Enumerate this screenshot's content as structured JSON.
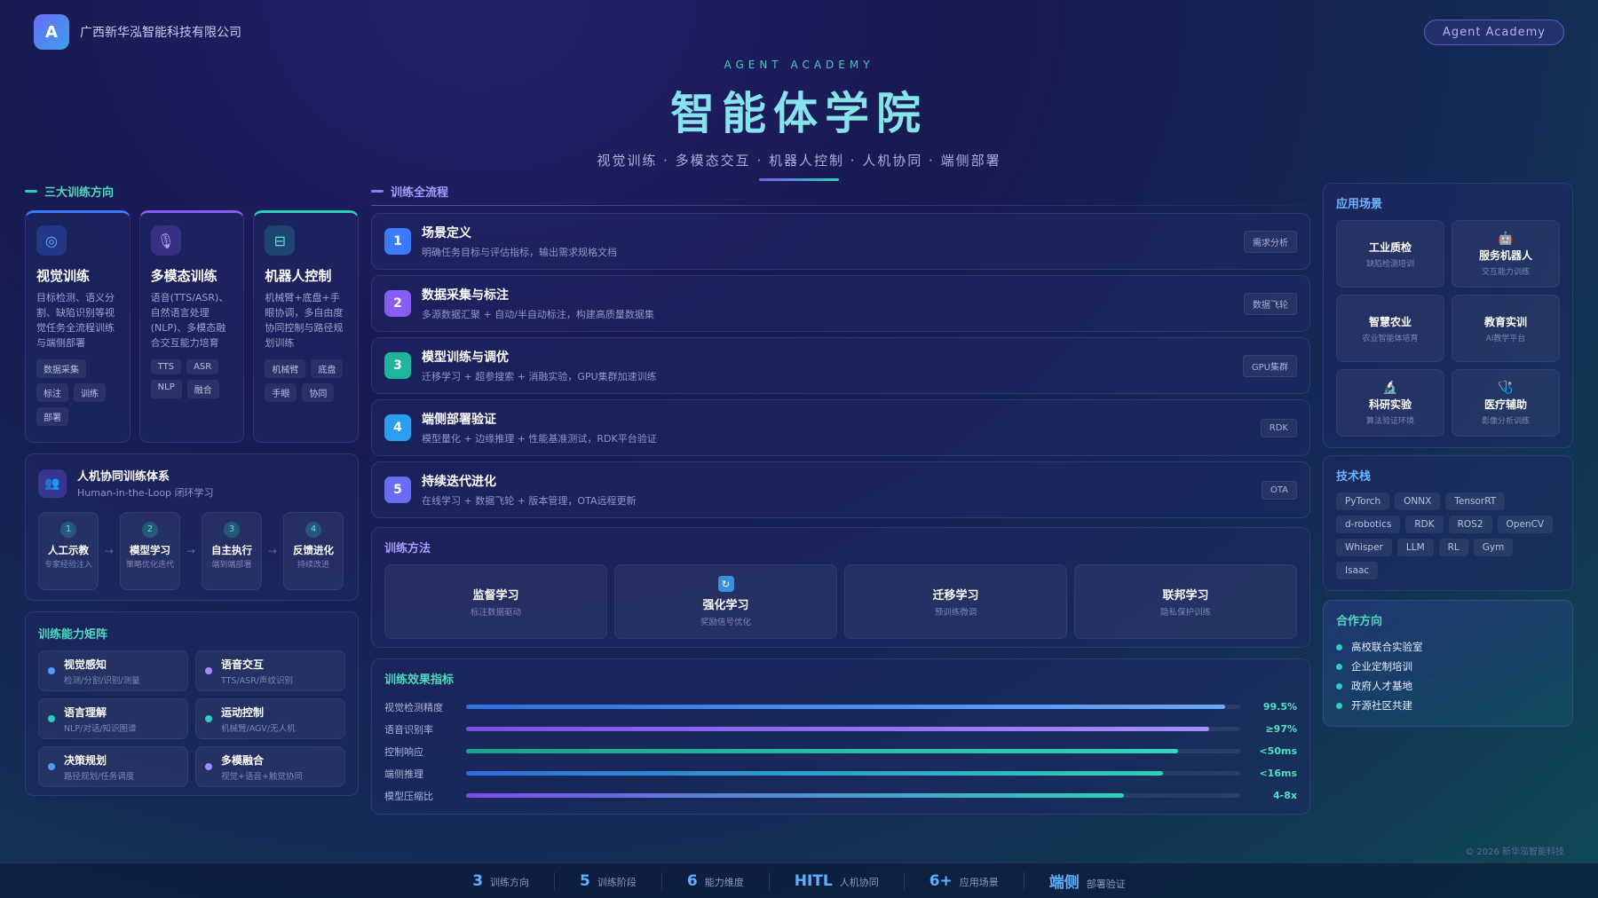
{
  "brand": {
    "logo_letter": "A",
    "name": "广西新华泓智能科技有限公司",
    "badge": "Agent Academy"
  },
  "hero": {
    "kicker": "AGENT ACADEMY",
    "title": "智能体学院",
    "subtitle": "视觉训练 · 多模态交互 · 机器人控制 · 人机协同 · 端侧部署"
  },
  "left": {
    "section_title": "三大训练方向",
    "directions": [
      {
        "icon": "target-icon",
        "glyph": "◎",
        "title": "视觉训练",
        "desc": "目标检测、语义分割、缺陷识别等视觉任务全流程训练与端侧部署",
        "chips": [
          "数据采集",
          "标注",
          "训练",
          "部署"
        ],
        "color": "#3b7bff"
      },
      {
        "icon": "microphone-icon",
        "glyph": "🎙",
        "title": "多模态训练",
        "desc": "语音(TTS/ASR)、自然语言处理(NLP)、多模态融合交互能力培育",
        "chips": [
          "TTS",
          "ASR",
          "NLP",
          "融合"
        ],
        "color": "#8a5cf6"
      },
      {
        "icon": "robot-control-icon",
        "glyph": "⊟",
        "title": "机器人控制",
        "desc": "机械臂+底盘+手眼协调，多自由度协同控制与路径规划训练",
        "chips": [
          "机械臂",
          "底盘",
          "手眼",
          "协同"
        ],
        "color": "#2ad1b8"
      }
    ],
    "hitl": {
      "title": "人机协同训练体系",
      "subtitle": "Human-in-the-Loop 闭环学习",
      "steps": [
        {
          "num": "1",
          "title": "人工示教",
          "desc": "专家经验注入"
        },
        {
          "num": "2",
          "title": "模型学习",
          "desc": "策略优化迭代"
        },
        {
          "num": "3",
          "title": "自主执行",
          "desc": "端到端部署"
        },
        {
          "num": "4",
          "title": "反馈进化",
          "desc": "持续改进"
        }
      ]
    },
    "matrix": {
      "title": "训练能力矩阵",
      "items": [
        {
          "name": "视觉感知",
          "desc": "检测/分割/识别/测量",
          "color": "#4f9dff"
        },
        {
          "name": "语音交互",
          "desc": "TTS/ASR/声纹识别",
          "color": "#a78bfa"
        },
        {
          "name": "语言理解",
          "desc": "NLP/对话/知识图谱",
          "color": "#2ad1b8"
        },
        {
          "name": "运动控制",
          "desc": "机械臂/AGV/无人机",
          "color": "#2ad1b8"
        },
        {
          "name": "决策规划",
          "desc": "路径规划/任务调度",
          "color": "#4f9dff"
        },
        {
          "name": "多模融合",
          "desc": "视觉+语音+触觉协同",
          "color": "#a78bfa"
        }
      ]
    }
  },
  "mid": {
    "section_title": "训练全流程",
    "flow": [
      {
        "num": "1",
        "title": "场景定义",
        "desc": "明确任务目标与评估指标，输出需求规格文档",
        "tag": "需求分析",
        "color": "#3b7bff"
      },
      {
        "num": "2",
        "title": "数据采集与标注",
        "desc": "多源数据汇聚 + 自动/半自动标注，构建高质量数据集",
        "tag": "数据飞轮",
        "color": "#8a5cf6"
      },
      {
        "num": "3",
        "title": "模型训练与调优",
        "desc": "迁移学习 + 超参搜索 + 消融实验，GPU集群加速训练",
        "tag": "GPU集群",
        "color": "#1fb59c"
      },
      {
        "num": "4",
        "title": "端侧部署验证",
        "desc": "模型量化 + 边缘推理 + 性能基准测试，RDK平台验证",
        "tag": "RDK",
        "color": "#2a9ff0"
      },
      {
        "num": "5",
        "title": "持续迭代进化",
        "desc": "在线学习 + 数据飞轮 + 版本管理，OTA远程更新",
        "tag": "OTA",
        "color": "#6a6cf6"
      }
    ],
    "methods": {
      "title": "训练方法",
      "items": [
        {
          "name": "监督学习",
          "desc": "标注数据驱动",
          "icon": ""
        },
        {
          "name": "强化学习",
          "desc": "奖励信号优化",
          "icon": "refresh-icon"
        },
        {
          "name": "迁移学习",
          "desc": "预训练微调",
          "icon": ""
        },
        {
          "name": "联邦学习",
          "desc": "隐私保护训练",
          "icon": ""
        }
      ]
    },
    "metrics": {
      "title": "训练效果指标",
      "items": [
        {
          "label": "视觉检测精度",
          "value": "99.5%",
          "fill": 0.98,
          "from": "#2f6fe0",
          "to": "#6aa8ff"
        },
        {
          "label": "语音识别率",
          "value": "≥97%",
          "fill": 0.96,
          "from": "#7b4fe8",
          "to": "#a98cff"
        },
        {
          "label": "控制响应",
          "value": "<50ms",
          "fill": 0.92,
          "from": "#1d9f8a",
          "to": "#33d6bd"
        },
        {
          "label": "端侧推理",
          "value": "<16ms",
          "fill": 0.9,
          "from": "#2f6fe0",
          "to": "#2ad1b8"
        },
        {
          "label": "模型压缩比",
          "value": "4-8x",
          "fill": 0.85,
          "from": "#7b4fe8",
          "to": "#2ad1b8"
        }
      ]
    }
  },
  "right": {
    "scenes": {
      "title": "应用场景",
      "items": [
        {
          "name": "工业质检",
          "desc": "缺陷检测培训",
          "icon": ""
        },
        {
          "name": "服务机器人",
          "desc": "交互能力训练",
          "icon": "robot-icon"
        },
        {
          "name": "智慧农业",
          "desc": "农业智能体培育",
          "icon": ""
        },
        {
          "name": "教育实训",
          "desc": "AI教学平台",
          "icon": ""
        },
        {
          "name": "科研实验",
          "desc": "算法验证环境",
          "icon": "microscope-icon"
        },
        {
          "name": "医疗辅助",
          "desc": "影像分析训练",
          "icon": "medical-icon"
        }
      ]
    },
    "stack": {
      "title": "技术栈",
      "items": [
        "PyTorch",
        "ONNX",
        "TensorRT",
        "d-robotics",
        "RDK",
        "ROS2",
        "OpenCV",
        "Whisper",
        "LLM",
        "RL",
        "Gym",
        "Isaac"
      ]
    },
    "partner": {
      "title": "合作方向",
      "items": [
        "高校联合实验室",
        "企业定制培训",
        "政府人才基地",
        "开源社区共建"
      ]
    }
  },
  "copyright": "© 2026 新华泓智能科技",
  "footer": [
    {
      "num": "3",
      "label": "训练方向"
    },
    {
      "num": "5",
      "label": "训练阶段"
    },
    {
      "num": "6",
      "label": "能力维度"
    },
    {
      "num": "HITL",
      "label": "人机协同"
    },
    {
      "num": "6+",
      "label": "应用场景"
    },
    {
      "num": "端侧",
      "label": "部署验证"
    }
  ]
}
